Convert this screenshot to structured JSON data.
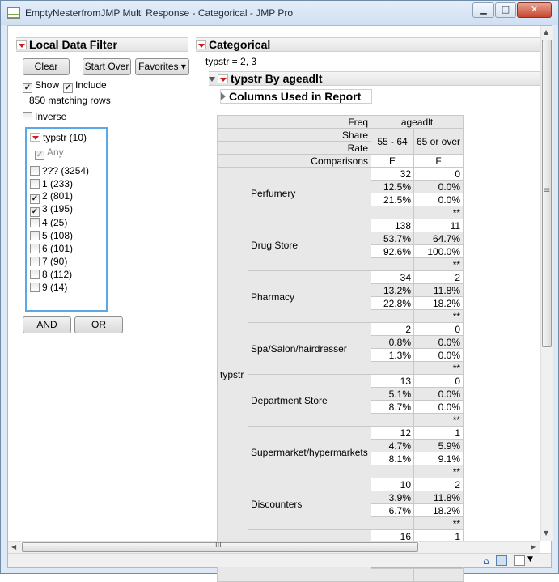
{
  "window": {
    "title": "EmptyNesterfromJMP Multi Response - Categorical - JMP Pro",
    "minimize": "▁",
    "maximize": "□",
    "close": "✕"
  },
  "filter": {
    "header": "Local Data Filter",
    "clear_label": "Clear",
    "start_over_label": "Start Over",
    "favorites_label": "Favorites ▾",
    "show_label": "Show",
    "include_label": "Include",
    "matching": "850 matching rows",
    "inverse_label": "Inverse",
    "var_label": "typstr (10)",
    "any_label": "Any",
    "levels": [
      {
        "label": "??? (3254)",
        "checked": false
      },
      {
        "label": "1 (233)",
        "checked": false
      },
      {
        "label": "2 (801)",
        "checked": true
      },
      {
        "label": "3 (195)",
        "checked": true
      },
      {
        "label": "4 (25)",
        "checked": false
      },
      {
        "label": "5 (108)",
        "checked": false
      },
      {
        "label": "6 (101)",
        "checked": false
      },
      {
        "label": "7 (90)",
        "checked": false
      },
      {
        "label": "8 (112)",
        "checked": false
      },
      {
        "label": "9 (14)",
        "checked": false
      }
    ],
    "and_label": "AND",
    "or_label": "OR"
  },
  "report": {
    "header": "Categorical",
    "where": "typstr = 2, 3",
    "sub_header": "typstr By ageadlt",
    "columns_used": "Columns Used in Report",
    "stat_labels": [
      "Freq",
      "Share",
      "Rate",
      "Comparisons"
    ],
    "group_var": "ageadlt",
    "col_headers": [
      "55 - 64",
      "65 or over"
    ],
    "col_letters": [
      "E",
      "F"
    ],
    "row_var": "typstr",
    "rows": [
      {
        "label": "Perfumery",
        "e": [
          "32",
          "12.5%",
          "21.5%",
          ""
        ],
        "f": [
          "0",
          "0.0%",
          "0.0%",
          "**"
        ]
      },
      {
        "label": "Drug Store",
        "e": [
          "138",
          "53.7%",
          "92.6%",
          ""
        ],
        "f": [
          "11",
          "64.7%",
          "100.0%",
          "**"
        ]
      },
      {
        "label": "Pharmacy",
        "e": [
          "34",
          "13.2%",
          "22.8%",
          ""
        ],
        "f": [
          "2",
          "11.8%",
          "18.2%",
          "**"
        ]
      },
      {
        "label": "Spa/Salon/hairdresser",
        "e": [
          "2",
          "0.8%",
          "1.3%",
          ""
        ],
        "f": [
          "0",
          "0.0%",
          "0.0%",
          "**"
        ]
      },
      {
        "label": "Department Store",
        "e": [
          "13",
          "5.1%",
          "8.7%",
          ""
        ],
        "f": [
          "0",
          "0.0%",
          "0.0%",
          "**"
        ]
      },
      {
        "label": "Supermarket/hypermarkets",
        "e": [
          "12",
          "4.7%",
          "8.1%",
          ""
        ],
        "f": [
          "1",
          "5.9%",
          "9.1%",
          "**"
        ]
      },
      {
        "label": "Discounters",
        "e": [
          "10",
          "3.9%",
          "6.7%",
          ""
        ],
        "f": [
          "2",
          "11.8%",
          "18.2%",
          "**"
        ]
      },
      {
        "label": "",
        "e": [
          "16",
          "",
          "",
          ""
        ],
        "f": [
          "1",
          "",
          "",
          ""
        ]
      }
    ]
  },
  "scroll": {
    "h_grip": "III",
    "v_grip": "≡"
  }
}
